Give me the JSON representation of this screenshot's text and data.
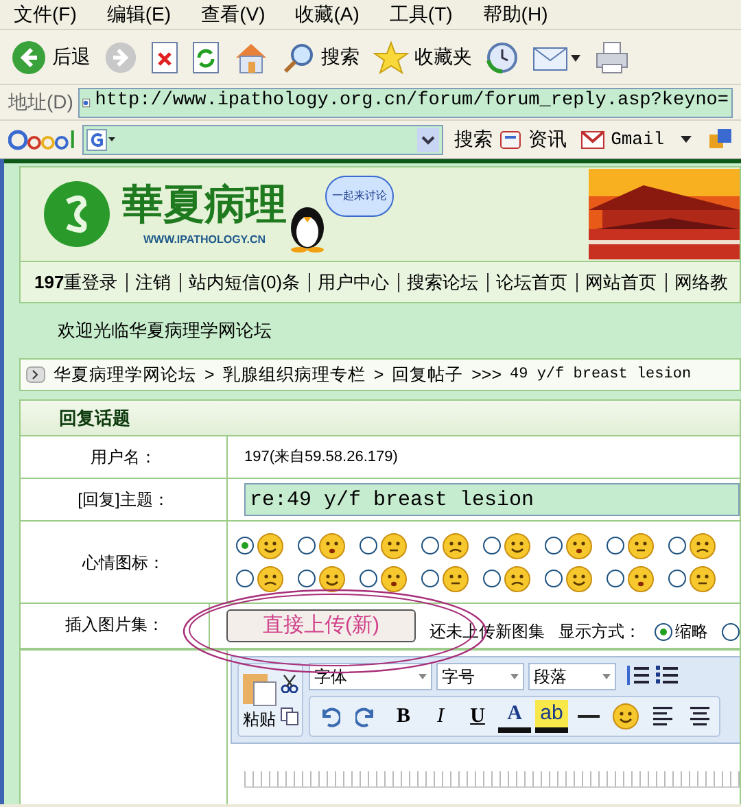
{
  "menu": [
    "文件(F)",
    "编辑(E)",
    "查看(V)",
    "收藏(A)",
    "工具(T)",
    "帮助(H)"
  ],
  "toolbar": [
    {
      "kind": "back",
      "label": "后退"
    },
    {
      "kind": "forward"
    },
    {
      "kind": "stop"
    },
    {
      "kind": "refresh"
    },
    {
      "kind": "home"
    },
    {
      "kind": "search",
      "label": "搜索"
    },
    {
      "kind": "favorites",
      "label": "收藏夹"
    },
    {
      "kind": "history"
    },
    {
      "kind": "mail"
    },
    {
      "kind": "print"
    }
  ],
  "address": {
    "label": "地址(D)",
    "url": "http://www.ipathology.org.cn/forum/forum_reply.asp?keyno="
  },
  "google_bar": {
    "search": "搜索",
    "news": "资讯",
    "gmail": "Gmail"
  },
  "site": {
    "title": "華夏病理",
    "url": "WWW.IPATHOLOGY.CN",
    "bubble": "一起来讨论"
  },
  "nav": [
    "**197**重登录",
    "注销",
    "站内短信(0)条",
    "用户中心",
    "搜索论坛",
    "论坛首页",
    "网站首页",
    "网络教"
  ],
  "welcome": "欢迎光临华夏病理学网论坛",
  "breadcrumb": [
    "华夏病理学网论坛",
    ">",
    "乳腺组织病理专栏",
    ">",
    "回复帖子",
    ">>>",
    "49 y/f breast lesion"
  ],
  "form": {
    "title": "回复话题",
    "username_label": "用户名：",
    "username": "197(来自59.58.26.179)",
    "subject_label": "[回复]主题：",
    "subject": "re:49 y/f breast lesion",
    "mood_label": "心情图标：",
    "moods": [
      {
        "selected": true
      },
      {
        "selected": false
      },
      {
        "selected": false
      },
      {
        "selected": false
      },
      {
        "selected": false
      },
      {
        "selected": false
      },
      {
        "selected": false
      },
      {
        "selected": false
      },
      {
        "selected": false
      },
      {
        "selected": false
      },
      {
        "selected": false
      },
      {
        "selected": false
      },
      {
        "selected": false
      },
      {
        "selected": false
      },
      {
        "selected": false
      },
      {
        "selected": false
      }
    ],
    "insert_label": "插入图片集：",
    "upload_button": "直接上传(新)",
    "upload_status": "还未上传新图集",
    "display_label": "显示方式：",
    "display_options": [
      {
        "label": "缩略",
        "selected": true
      },
      {
        "selected": false
      }
    ]
  },
  "editor": {
    "paste": "粘贴",
    "font": "字体",
    "size": "字号",
    "paragraph": "段落",
    "format_buttons": [
      {
        "kind": "undo"
      },
      {
        "kind": "redo"
      },
      {
        "kind": "bold",
        "label": "B"
      },
      {
        "kind": "italic",
        "label": "I"
      },
      {
        "kind": "underline",
        "label": "U"
      },
      {
        "kind": "color",
        "label": "A"
      },
      {
        "kind": "highlight",
        "label": "ab"
      },
      {
        "kind": "rule"
      },
      {
        "kind": "emoticon"
      },
      {
        "kind": "align-left"
      },
      {
        "kind": "align-center"
      }
    ]
  }
}
